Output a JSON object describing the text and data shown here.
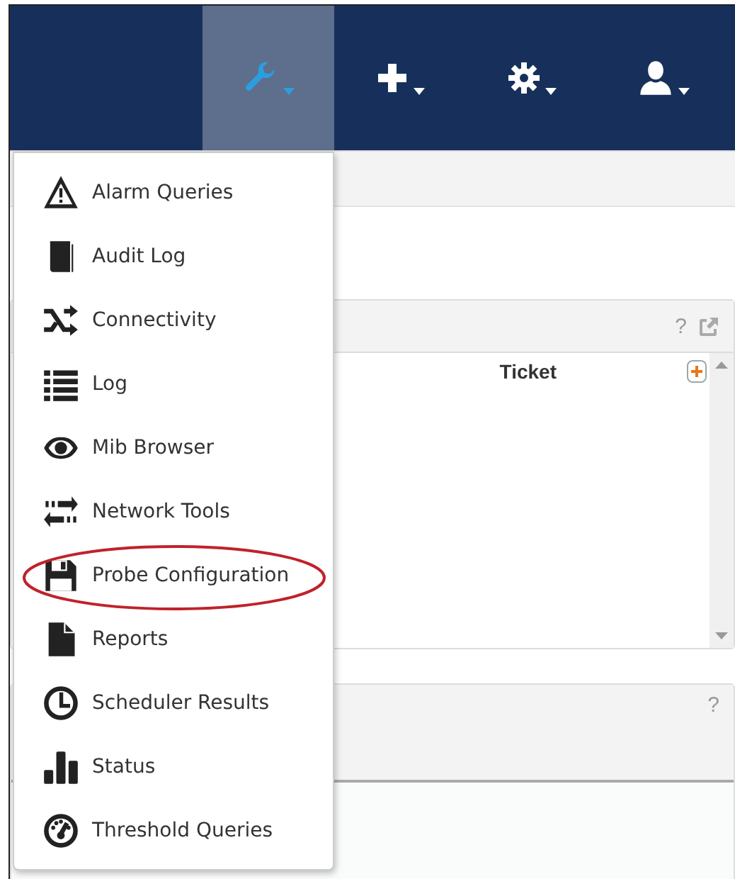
{
  "navbar": {
    "items": [
      {
        "selected": true
      },
      {
        "selected": false
      },
      {
        "selected": false
      },
      {
        "selected": false
      }
    ]
  },
  "menu": {
    "items": [
      {
        "label": "Alarm Queries",
        "circled": false
      },
      {
        "label": "Audit Log",
        "circled": false
      },
      {
        "label": "Connectivity",
        "circled": false
      },
      {
        "label": "Log",
        "circled": false
      },
      {
        "label": "Mib Browser",
        "circled": false
      },
      {
        "label": "Network Tools",
        "circled": false
      },
      {
        "label": "Probe Configuration",
        "circled": true
      },
      {
        "label": "Reports",
        "circled": false
      },
      {
        "label": "Scheduler Results",
        "circled": false
      },
      {
        "label": "Status",
        "circled": false
      },
      {
        "label": "Threshold Queries",
        "circled": false
      }
    ]
  },
  "panels": [
    {
      "help": "?",
      "external_link": true,
      "columns": [
        "Ticket"
      ]
    },
    {
      "help": "?",
      "external_link": false
    }
  ]
}
